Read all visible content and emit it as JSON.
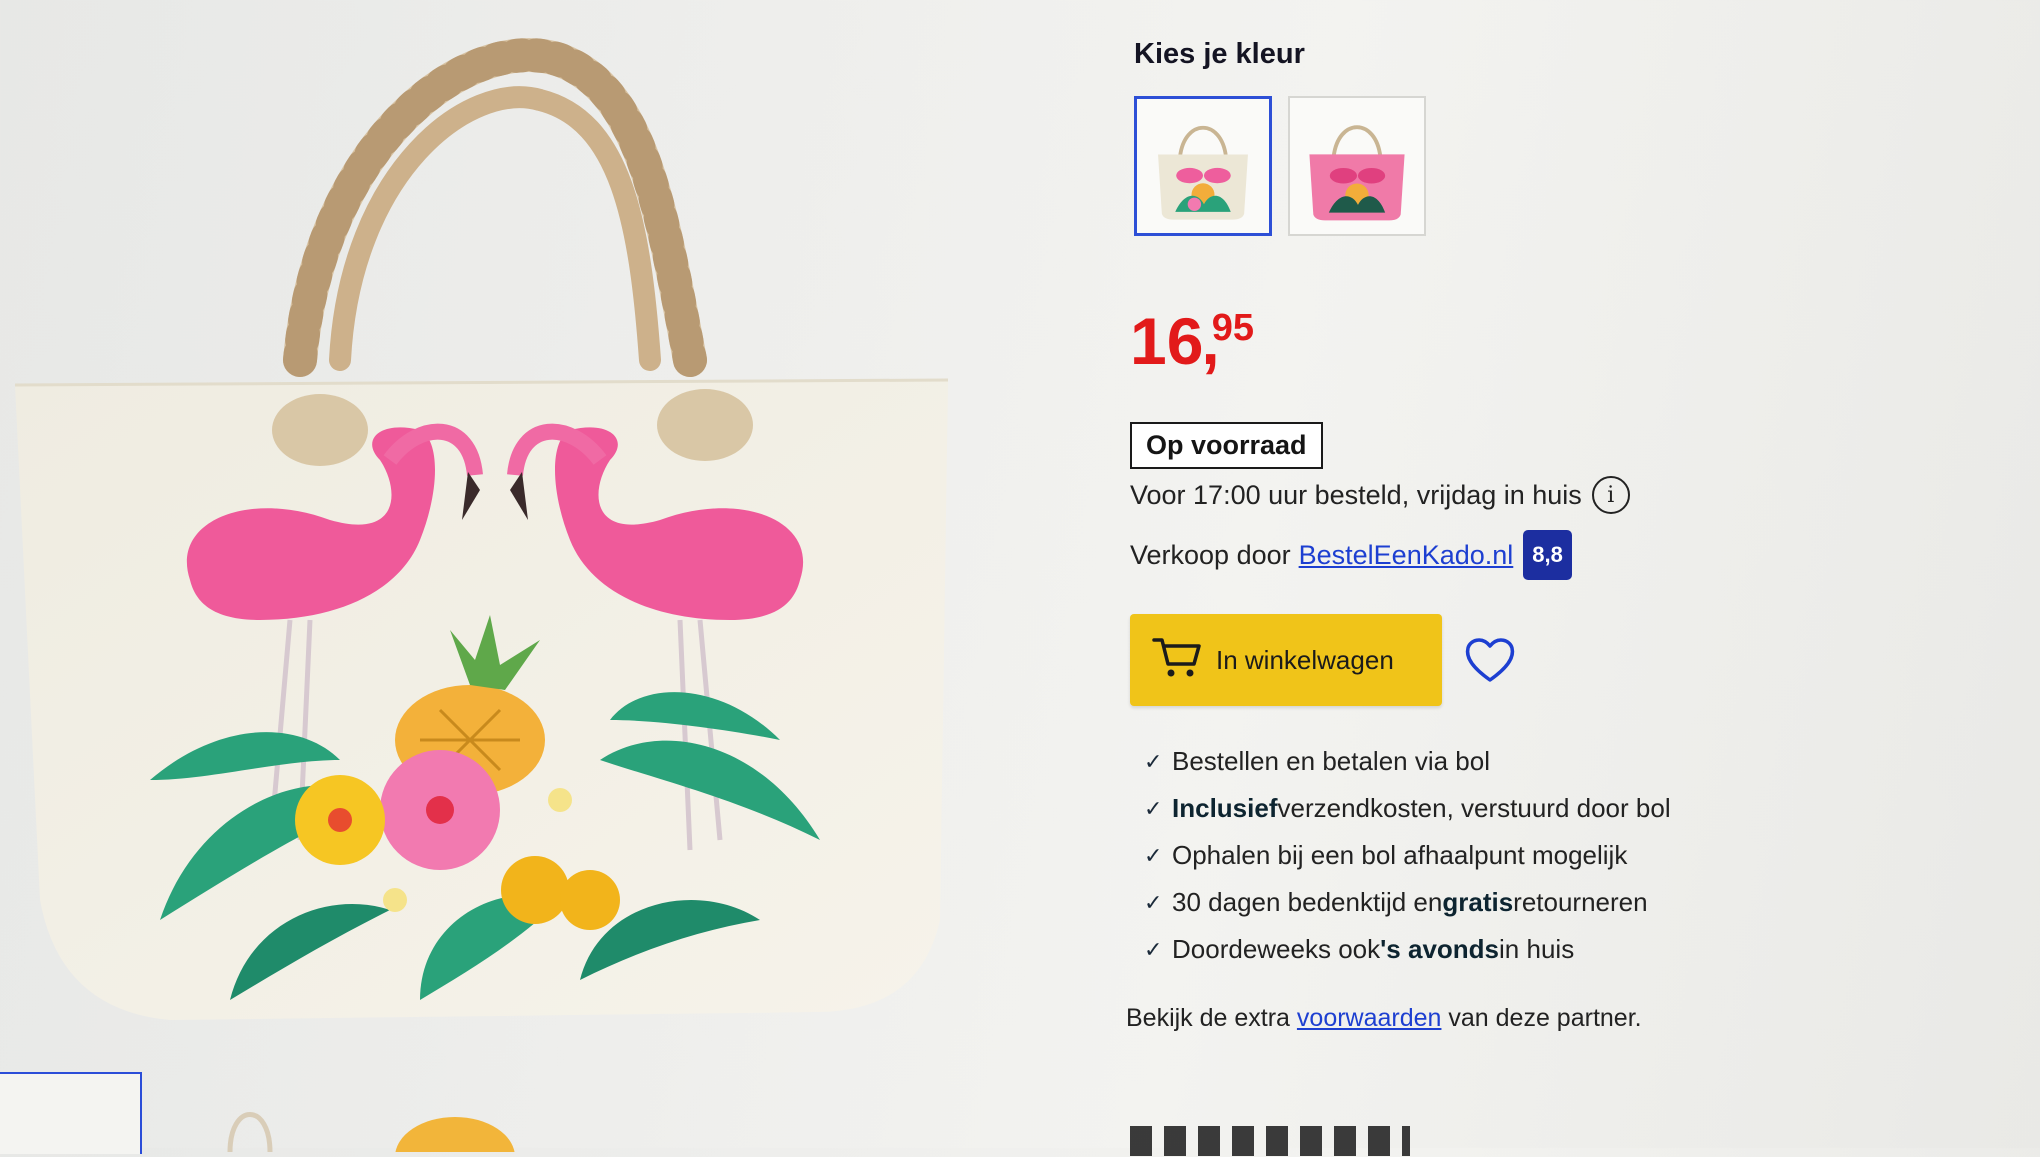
{
  "color_picker": {
    "title": "Kies je kleur",
    "options": [
      {
        "label": "Naturel flamingo tas",
        "selected": true
      },
      {
        "label": "Roze flamingo tas",
        "selected": false
      }
    ]
  },
  "price": {
    "whole": "16",
    "separator": ",",
    "fraction": "95",
    "color": "#e21a1a"
  },
  "stock": {
    "label": "Op voorraad"
  },
  "delivery": {
    "text": "Voor 17:00 uur besteld, vrijdag in huis",
    "info_icon": "info-icon"
  },
  "seller": {
    "prefix": "Verkoop door",
    "name": "BestelEenKado.nl",
    "rating": "8,8"
  },
  "cart": {
    "label": "In winkelwagen",
    "icon": "shopping-cart-icon",
    "color": "#f0c419"
  },
  "wishlist": {
    "icon": "heart-icon"
  },
  "usps": [
    {
      "before": "Bestellen en betalen via bol",
      "bold": "",
      "after": ""
    },
    {
      "before": "",
      "bold": "Inclusief",
      "after": " verzendkosten, verstuurd door bol"
    },
    {
      "before": "Ophalen bij een bol afhaalpunt mogelijk",
      "bold": "",
      "after": ""
    },
    {
      "before": "30 dagen bedenktijd en ",
      "bold": "gratis",
      "after": " retourneren"
    },
    {
      "before": "Doordeweeks ook ",
      "bold": "'s avonds",
      "after": " in huis"
    }
  ],
  "conditions": {
    "before": "Bekijk de extra ",
    "link": "voorwaarden",
    "after": " van deze partner."
  },
  "colors": {
    "accent_link": "#1d3fd1",
    "rating_bg": "#1c2ea0"
  }
}
